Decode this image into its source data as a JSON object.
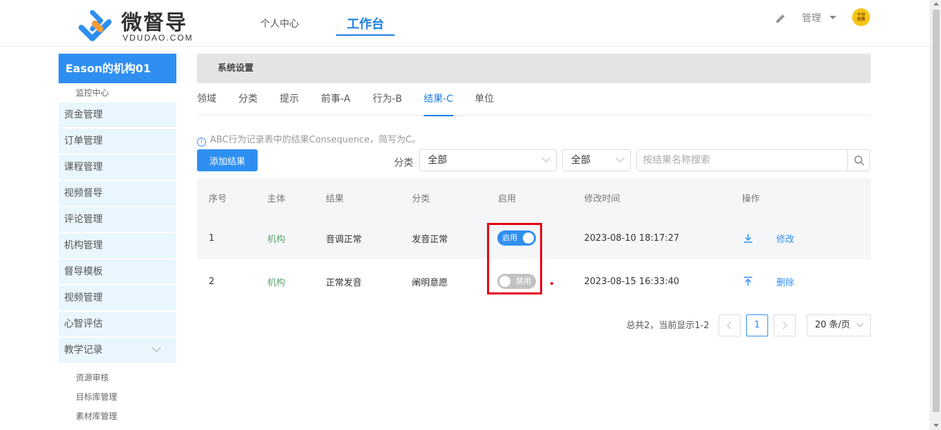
{
  "header": {
    "logo_title": "微督导",
    "logo_sub": "VDUDAO.COM",
    "nav": [
      {
        "label": "个人中心"
      },
      {
        "label": "工作台"
      }
    ],
    "admin_label": "管理",
    "avatar_text": [
      "十分",
      "优秀"
    ]
  },
  "sidebar": {
    "org_title": "Eason的机构01",
    "top_sub": "监控中心",
    "items": [
      {
        "label": "资金管理"
      },
      {
        "label": "订单管理"
      },
      {
        "label": "课程管理"
      },
      {
        "label": "视频督导"
      },
      {
        "label": "评论管理"
      },
      {
        "label": "机构管理"
      },
      {
        "label": "督导模板"
      },
      {
        "label": "视频管理"
      },
      {
        "label": "心智评估"
      },
      {
        "label": "教学记录"
      }
    ],
    "sub_items": [
      {
        "label": "资源审核"
      },
      {
        "label": "目标库管理"
      },
      {
        "label": "素材库管理"
      }
    ]
  },
  "main": {
    "section_title": "系统设置",
    "tabs": [
      {
        "label": "领域"
      },
      {
        "label": "分类"
      },
      {
        "label": "提示"
      },
      {
        "label": "前事-A"
      },
      {
        "label": "行为-B"
      },
      {
        "label": "结果-C"
      },
      {
        "label": "单位"
      }
    ],
    "active_tab": "结果-C",
    "info_text": "ABC行为记录表中的结果Consequence，简写为C。",
    "add_button": "添加结果",
    "filter_label": "分类",
    "filter_select1": "全部",
    "filter_select2": "全部",
    "search_placeholder": "按结果名称搜索",
    "table": {
      "headers": [
        "序号",
        "主体",
        "结果",
        "分类",
        "启用",
        "修改时间",
        "操作"
      ],
      "rows": [
        {
          "index": "1",
          "subject": "机构",
          "result": "音调正常",
          "category": "发音正常",
          "toggle": "启用",
          "enabled": true,
          "modified": "2023-08-10 18:17:27",
          "action": "修改"
        },
        {
          "index": "2",
          "subject": "机构",
          "result": "正常发音",
          "category": "阐明意愿",
          "toggle": "禁用",
          "enabled": false,
          "modified": "2023-08-15 16:33:40",
          "action": "删除"
        }
      ]
    },
    "pagination": {
      "summary": "总共2，当前显示1-2",
      "current_page": "1",
      "page_size": "20 条/页"
    }
  },
  "colors": {
    "accent": "#2f8ff0",
    "sidebar_bg": "#e9f6fd",
    "highlight": "#e60012",
    "subject_green": "#5aa56e"
  }
}
